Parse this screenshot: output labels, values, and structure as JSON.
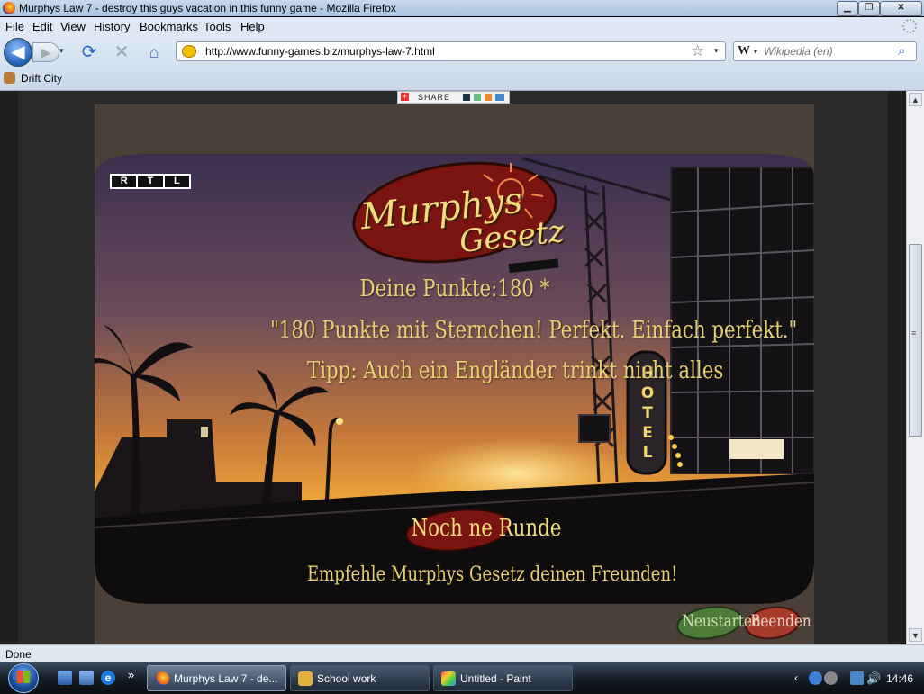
{
  "window": {
    "title": "Murphys Law 7 - destroy this guys vacation in this funny game - Mozilla Firefox",
    "controls": {
      "minimize": "▁",
      "maximize": "❐",
      "close": "✕"
    }
  },
  "menu": [
    "File",
    "Edit",
    "View",
    "History",
    "Bookmarks",
    "Tools",
    "Help"
  ],
  "nav": {
    "back": "◀",
    "forward": "▶",
    "history_dropdown": "▾",
    "reload": "⟳",
    "stop": "✕",
    "home": "⌂",
    "url": "http://www.funny-games.biz/murphys-law-7.html",
    "bookmark_star": "☆",
    "url_dropdown": "▾",
    "search_engine": "W",
    "search_engine_dropdown": "▾",
    "search_placeholder": "Wikipedia (en)",
    "search_go": "⌕"
  },
  "bookmarks": [
    {
      "label": "Drift City"
    }
  ],
  "share_widget": {
    "label": "SHARE",
    "plus": "+"
  },
  "game": {
    "broadcaster_logo": [
      "R",
      "T",
      "L"
    ],
    "logo_word1": "Murphys",
    "logo_word2": "Gesetz",
    "score": "Deine Punkte:180 *",
    "quote": "\"180 Punkte mit Sternchen! Perfekt. Einfach perfekt.\"",
    "tip": "Tipp: Auch ein Engländer trinkt nicht alles",
    "play_again": "Noch ne Runde",
    "recommend": "Empfehle Murphys Gesetz deinen Freunden!",
    "restart": "Neustarten",
    "quit": "Beenden",
    "hotel_sign": [
      "H",
      "O",
      "T",
      "E",
      "L"
    ],
    "colors": {
      "text": "#e8cf72",
      "logo_ellipse": "#7a1410",
      "restart_btn": "#4e7a3a",
      "quit_btn": "#a83a2c"
    }
  },
  "scrollbar": {
    "up": "▲",
    "down": "▼",
    "grip": "≡"
  },
  "status": "Done",
  "taskbar": {
    "more": "»",
    "tasks": [
      {
        "label": "Murphys Law 7 - de...",
        "active": true
      },
      {
        "label": "School work",
        "active": false
      },
      {
        "label": "Untitled - Paint",
        "active": false
      }
    ],
    "tray_chevron": "‹",
    "volume": "🔊",
    "clock": "14:46"
  }
}
